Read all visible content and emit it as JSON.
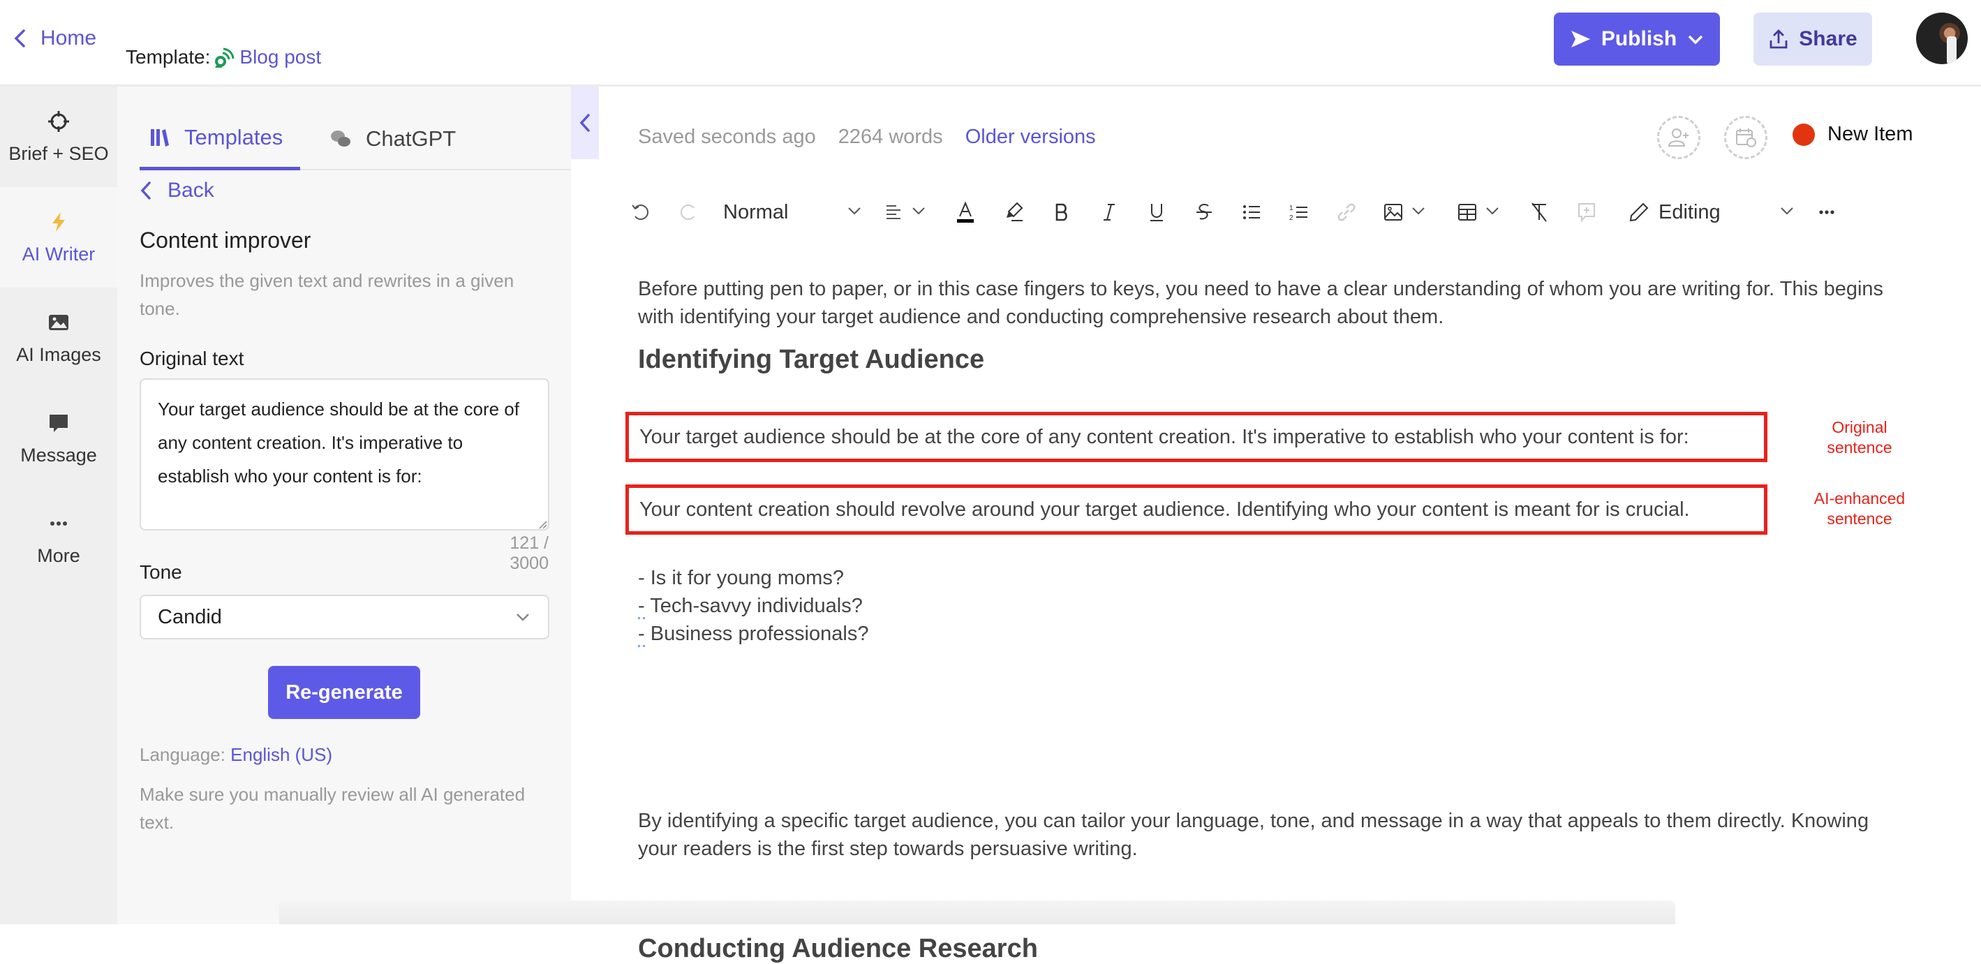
{
  "header": {
    "home_label": "Home",
    "template_prefix": "Template:",
    "template_name": "Blog post",
    "publish_label": "Publish",
    "share_label": "Share"
  },
  "rail": {
    "items": [
      {
        "label": "Brief + SEO",
        "icon": "crosshair-icon"
      },
      {
        "label": "AI Writer",
        "icon": "lightning-icon",
        "active": true
      },
      {
        "label": "AI Images",
        "icon": "image-icon"
      },
      {
        "label": "Message",
        "icon": "chat-bubble-icon"
      },
      {
        "label": "More",
        "icon": "more-dots-icon"
      }
    ]
  },
  "panel": {
    "tabs": [
      {
        "label": "Templates",
        "icon": "books-icon",
        "active": true
      },
      {
        "label": "ChatGPT",
        "icon": "chat-bubbles-icon"
      }
    ],
    "back_label": "Back",
    "title": "Content improver",
    "description": "Improves the given text and rewrites in a given tone.",
    "original_text_label": "Original text",
    "original_text_value": "Your target audience should be at the core of any content creation. It's imperative to establish who your content is for:",
    "char_count": "121 / 3000",
    "tone_label": "Tone",
    "tone_value": "Candid",
    "regenerate_label": "Re-generate",
    "language_prefix": "Language:",
    "language_value": "English (US)",
    "review_note": "Make sure you manually review all AI generated text."
  },
  "editor": {
    "saved_status": "Saved seconds ago",
    "word_count": "2264 words",
    "older_versions_label": "Older versions",
    "item_status_label": "New Item",
    "item_status_color": "#e2350f",
    "toolbar": {
      "style_value": "Normal",
      "mode_value": "Editing"
    },
    "content": {
      "intro": "Before putting pen to paper, or in this case fingers to keys, you need to have a clear understanding of whom you are writing for. This begins with identifying your target audience and conducting comprehensive research about them.",
      "heading1": "Identifying Target Audience",
      "original_sentence": "Your target audience should be at the core of any content creation. It's imperative to establish who your content is for:",
      "enhanced_sentence": "Your content creation should revolve around your target audience. Identifying who your content is meant for is crucial.",
      "annotation_original": "Original sentence",
      "annotation_enhanced": "AI-enhanced sentence",
      "list": [
        {
          "dash": "-",
          "text": " Is it for young moms?"
        },
        {
          "dash": "-",
          "text": " Tech-savvy individuals?"
        },
        {
          "dash": "-",
          "text": " Business professionals?"
        }
      ],
      "paragraph2": "By identifying a specific target audience, you can tailor your language, tone, and message in a way that appeals to them directly. Knowing your readers is the first step towards persuasive writing.",
      "heading2": "Conducting Audience Research"
    },
    "annotation_color": "#e8221a"
  },
  "colors": {
    "accent": "#5e5ae8",
    "accent_text": "#5b55d6",
    "share_bg": "#dfe3f7"
  }
}
